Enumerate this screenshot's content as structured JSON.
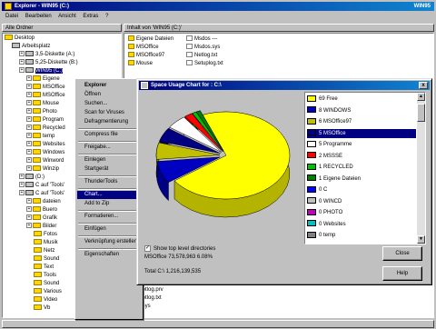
{
  "window": {
    "title": "Explorer - WIN95 (C:)",
    "title_right": "WIN95"
  },
  "menu": [
    "Datei",
    "Bearbeiten",
    "Ansicht",
    "Extras",
    "?"
  ],
  "tree_header": "Alle Ordner",
  "list_header": "Inhalt von 'WIN95 (C:)'",
  "tree": [
    {
      "label": "Desktop",
      "indent": 0,
      "type": "folder"
    },
    {
      "label": "Arbeitsplatz",
      "indent": 1,
      "type": "drive"
    },
    {
      "label": "3,5-Diskette (A:)",
      "indent": 2,
      "type": "drive"
    },
    {
      "label": "5,25-Diskette (B:)",
      "indent": 2,
      "type": "drive"
    },
    {
      "label": "WIN95 (C:)",
      "indent": 2,
      "type": "drive",
      "selected": true
    },
    {
      "label": "Eigene",
      "indent": 3,
      "type": "folder"
    },
    {
      "label": "MSOffice",
      "indent": 3,
      "type": "folder"
    },
    {
      "label": "MSOffice",
      "indent": 3,
      "type": "folder"
    },
    {
      "label": "Mouse",
      "indent": 3,
      "type": "folder"
    },
    {
      "label": "Photo",
      "indent": 3,
      "type": "folder"
    },
    {
      "label": "Program",
      "indent": 3,
      "type": "folder"
    },
    {
      "label": "Recycled",
      "indent": 3,
      "type": "folder"
    },
    {
      "label": "temp",
      "indent": 3,
      "type": "folder"
    },
    {
      "label": "Websites",
      "indent": 3,
      "type": "folder"
    },
    {
      "label": "Windows",
      "indent": 3,
      "type": "folder"
    },
    {
      "label": "Winword",
      "indent": 3,
      "type": "folder"
    },
    {
      "label": "Winzip",
      "indent": 3,
      "type": "folder"
    },
    {
      "label": "(D:)",
      "indent": 2,
      "type": "drive"
    },
    {
      "label": "C auf 'Tools'",
      "indent": 2,
      "type": "drive"
    },
    {
      "label": "C auf 'Tools'",
      "indent": 2,
      "type": "drive"
    },
    {
      "label": "dateien",
      "indent": 3,
      "type": "folder"
    },
    {
      "label": "Buero",
      "indent": 3,
      "type": "folder"
    },
    {
      "label": "Grafik",
      "indent": 3,
      "type": "folder"
    },
    {
      "label": "Bilder",
      "indent": 3,
      "type": "folder"
    },
    {
      "label": "Fotos",
      "indent": 4,
      "type": "folder"
    },
    {
      "label": "Musik",
      "indent": 4,
      "type": "folder"
    },
    {
      "label": "Netz",
      "indent": 4,
      "type": "folder"
    },
    {
      "label": "Sound",
      "indent": 4,
      "type": "folder"
    },
    {
      "label": "Text",
      "indent": 4,
      "type": "folder"
    },
    {
      "label": "Tools",
      "indent": 4,
      "type": "folder"
    },
    {
      "label": "Sound",
      "indent": 4,
      "type": "folder"
    },
    {
      "label": "Various",
      "indent": 4,
      "type": "folder"
    },
    {
      "label": "Video",
      "indent": 4,
      "type": "folder"
    },
    {
      "label": "Vb",
      "indent": 4,
      "type": "folder"
    }
  ],
  "files_col1": [
    {
      "label": "Eigene Dateien",
      "type": "folder"
    },
    {
      "label": "MSOffice",
      "type": "folder"
    },
    {
      "label": "MSOffice97",
      "type": "folder"
    },
    {
      "label": "Mouse",
      "type": "folder"
    }
  ],
  "files_col2": [
    {
      "label": "Msdos ---",
      "type": "file"
    },
    {
      "label": "Msdos.sys",
      "type": "file"
    },
    {
      "label": "Netlog.txt",
      "type": "file"
    },
    {
      "label": "Setuplog.txt",
      "type": "file"
    }
  ],
  "files_bottom": [
    {
      "label": "bootlog.prv",
      "type": "file"
    },
    {
      "label": "bootlog.txt",
      "type": "file"
    },
    {
      "label": "Io.sys",
      "type": "file"
    }
  ],
  "context_menu": [
    {
      "label": "Explorer",
      "bold": true
    },
    {
      "label": "Öffnen"
    },
    {
      "label": "Suchen..."
    },
    {
      "label": "Scan for Viruses"
    },
    {
      "label": "Defragmentierung"
    },
    {
      "sep": true
    },
    {
      "label": "Compress file"
    },
    {
      "sep": true
    },
    {
      "label": "Freigabe..."
    },
    {
      "sep": true
    },
    {
      "label": "Einlegen"
    },
    {
      "label": "Startgerät"
    },
    {
      "sep": true
    },
    {
      "label": "ThunderTools"
    },
    {
      "sep": true
    },
    {
      "label": "Chart...",
      "highlight": true
    },
    {
      "label": "Add to Zip"
    },
    {
      "sep": true
    },
    {
      "label": "Formatieren..."
    },
    {
      "sep": true
    },
    {
      "label": "Einfügen"
    },
    {
      "sep": true
    },
    {
      "label": "Verknüpfung erstellen"
    },
    {
      "sep": true
    },
    {
      "label": "Eigenschaften"
    }
  ],
  "dialog": {
    "title": "Space Usage Chart for : C:\\",
    "close_glyph": "x",
    "checkbox_label": "Show top level directories",
    "checkbox_mark": "✓",
    "selected_line": "MSOffice   73,578,963   6.08%",
    "total_line": "Total C:\\   1,216,139,535",
    "buttons": {
      "close": "Close",
      "help": "Help"
    }
  },
  "legend": [
    {
      "label": "69 Free",
      "color": "#ffff00"
    },
    {
      "label": "8 WINDOWS",
      "color": "#0000c0"
    },
    {
      "label": "6 MSOffice97",
      "color": "#c0c000"
    },
    {
      "label": "5 MSOffice",
      "color": "#000080",
      "highlight": true
    },
    {
      "label": "5 Programme",
      "color": "#ffffff"
    },
    {
      "label": "2 MSSSE",
      "color": "#ff0000"
    },
    {
      "label": "1 RECYCLED",
      "color": "#00c000"
    },
    {
      "label": "1 Eigene Dateien",
      "color": "#008000"
    },
    {
      "label": "0 C",
      "color": "#0000ff"
    },
    {
      "label": "0 WINCD",
      "color": "#c0c0c0"
    },
    {
      "label": "0 PHOTO",
      "color": "#c000c0"
    },
    {
      "label": "0 Websites",
      "color": "#00c0c0"
    },
    {
      "label": "0 temp",
      "color": "#808080"
    }
  ],
  "chart_data": {
    "type": "pie",
    "title": "Space Usage Chart for : C:\\",
    "categories": [
      "Free",
      "WINDOWS",
      "MSOffice97",
      "MSOffice",
      "Programme",
      "MSSSE",
      "RECYCLED",
      "Eigene Dateien",
      "C",
      "WINCD",
      "PHOTO",
      "Websites",
      "temp"
    ],
    "values": [
      69,
      8,
      6,
      5,
      5,
      2,
      1,
      1,
      0,
      0,
      0,
      0,
      0
    ],
    "colors": [
      "#ffff00",
      "#0000c0",
      "#c0c000",
      "#000080",
      "#ffffff",
      "#ff0000",
      "#00c000",
      "#008000",
      "#0000ff",
      "#c0c0c0",
      "#c000c0",
      "#00c0c0",
      "#808080"
    ],
    "style": "3d"
  }
}
